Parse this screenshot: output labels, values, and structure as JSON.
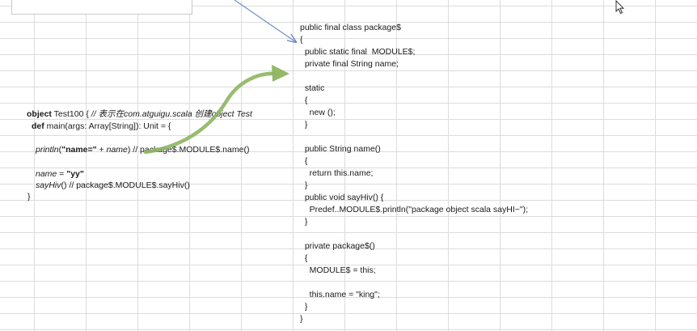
{
  "left_code": {
    "line1": {
      "kw_object": "object",
      "name": " Test100 { ",
      "comment": "// 表示在com.atguigu.scala 创建object Test"
    },
    "line2": {
      "kw_def": "def",
      "rest": " main(args: Array[String]): Unit = {"
    },
    "line3": {
      "fn": "println",
      "open": "(",
      "str": "\"name=\"",
      "plus": " + ",
      "var": "name",
      "close": ") ",
      "comment": "// package$.MODULE$.name()"
    },
    "line4": {
      "var": "name",
      "eq": " = ",
      "str": "\"yy\""
    },
    "line5": {
      "fn": "sayHiv",
      "rest": "() ",
      "comment": "// package$.MODULE$.sayHiv()"
    },
    "line6": "}"
  },
  "right_code": [
    "public final class package$",
    "{",
    "  public static final  MODULE$;",
    "  private final String name;",
    "",
    "  static",
    "  {",
    "    new ();",
    "  }",
    "",
    "  public String name()",
    "  {",
    "    return this.name;",
    "  }",
    "  public void sayHiv() {",
    "    Predef..MODULE$.println(\"package object scala sayHI~\");",
    "  }",
    "",
    "  private package$()",
    "  {",
    "    MODULE$ = this;",
    "",
    "    this.name = \"king\";",
    "  }",
    "}"
  ],
  "colors": {
    "arrow_green": "#8db561",
    "arrow_blue": "#6d8fc7",
    "gridline": "#dcdcdc"
  },
  "icons": {
    "cursor": "mouse-pointer-icon"
  }
}
